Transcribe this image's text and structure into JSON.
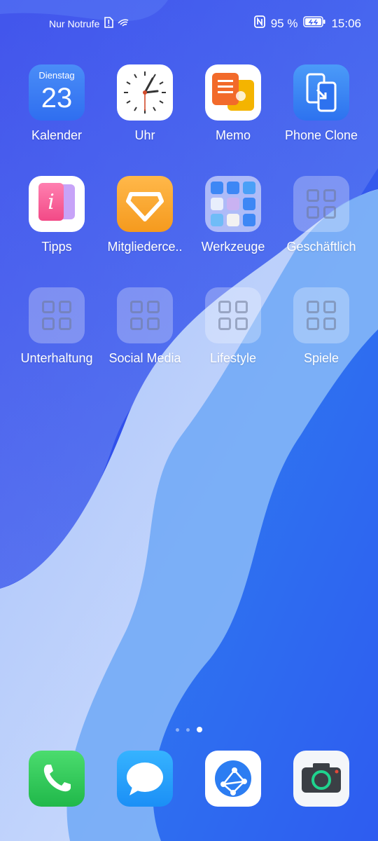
{
  "status_bar": {
    "carrier_text": "Nur Notrufe",
    "battery_percent": "95 %",
    "time": "15:06",
    "icons": [
      "sim-alert-icon",
      "wifi-calling-icon",
      "nfc-icon",
      "battery-icon"
    ]
  },
  "apps": {
    "row1": [
      {
        "label": "Kalender",
        "weekday": "Dienstag",
        "day": "23",
        "icon": "calendar-icon"
      },
      {
        "label": "Uhr",
        "icon": "clock-icon"
      },
      {
        "label": "Memo",
        "icon": "memo-icon"
      },
      {
        "label": "Phone Clone",
        "icon": "phone-clone-icon"
      }
    ],
    "row2": [
      {
        "label": "Tipps",
        "icon": "tips-icon"
      },
      {
        "label": "Mitgliederce..",
        "icon": "member-center-icon"
      },
      {
        "label": "Werkzeuge",
        "icon": "tools-folder-icon"
      },
      {
        "label": "Geschäftlich",
        "icon": "folder-icon"
      }
    ],
    "row3": [
      {
        "label": "Unterhaltung",
        "icon": "folder-icon"
      },
      {
        "label": "Social Media",
        "icon": "folder-icon"
      },
      {
        "label": "Lifestyle",
        "icon": "folder-icon"
      },
      {
        "label": "Spiele",
        "icon": "folder-icon"
      }
    ]
  },
  "pager": {
    "pages": 3,
    "current": 3
  },
  "dock": [
    {
      "icon": "phone-icon"
    },
    {
      "icon": "messages-icon"
    },
    {
      "icon": "browser-icon"
    },
    {
      "icon": "camera-icon"
    }
  ],
  "colors": {
    "wallpaper_top": "#2c3cf0",
    "wallpaper_light": "#bcd2fb",
    "accent_blue": "#3c7ef2"
  }
}
